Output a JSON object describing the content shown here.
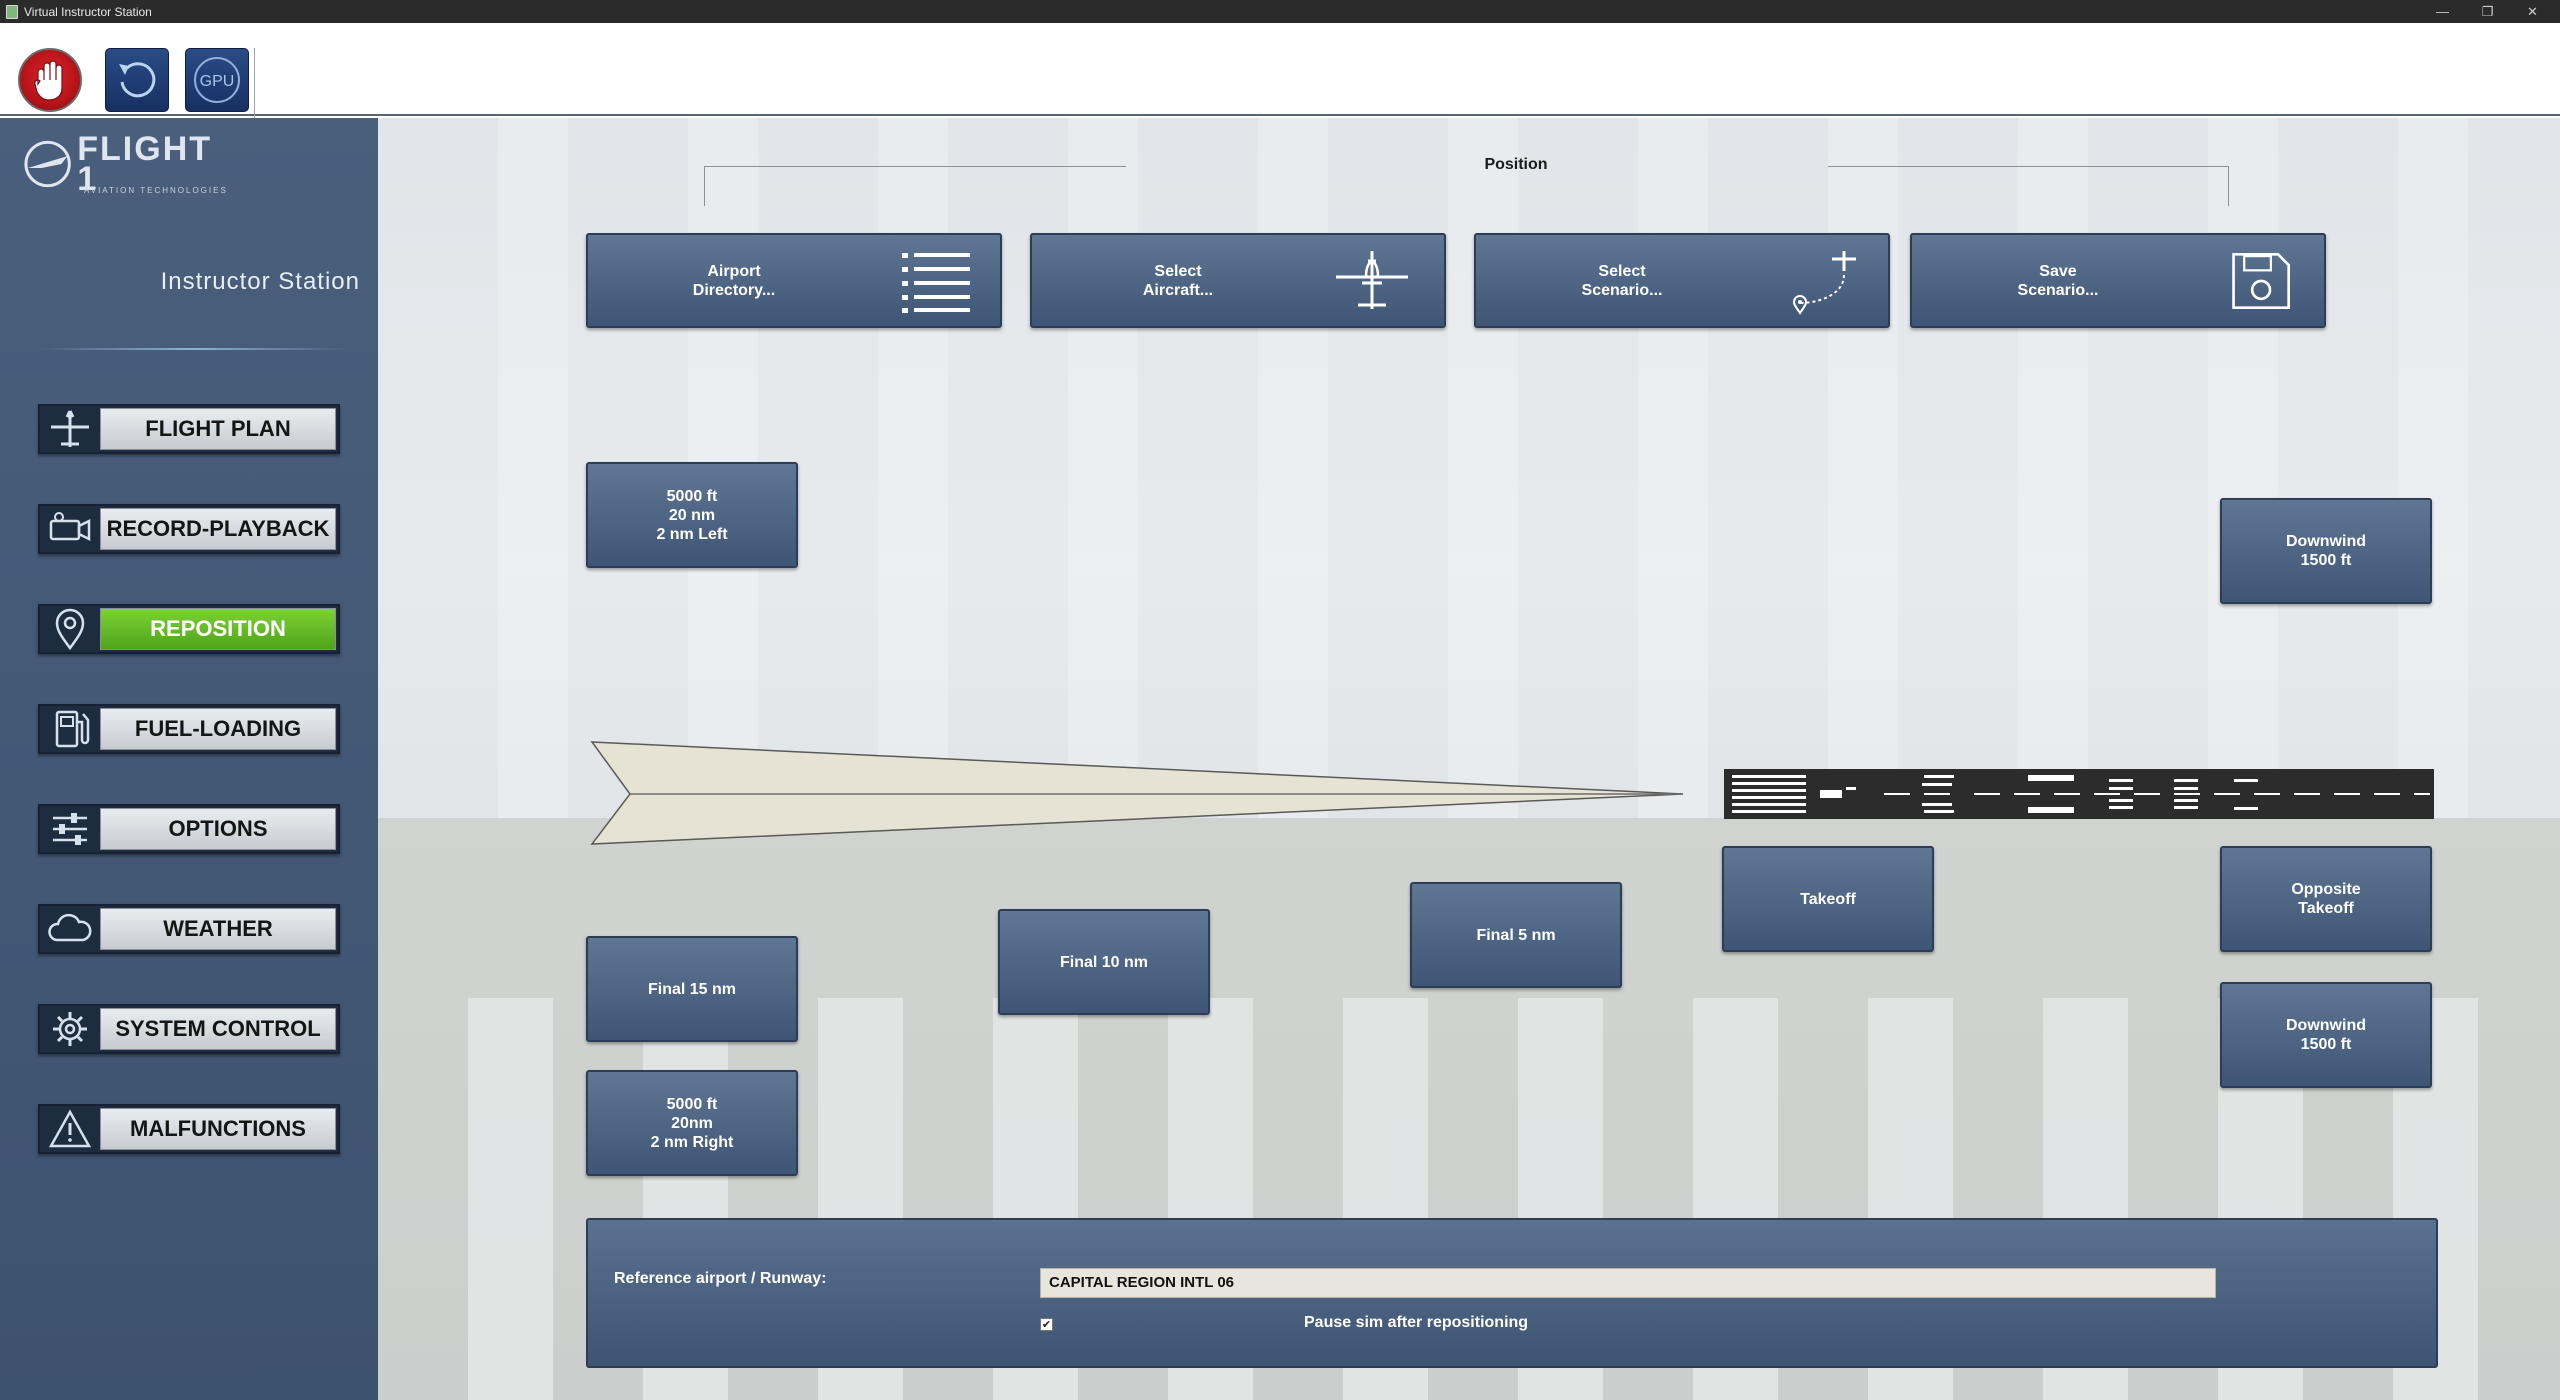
{
  "window": {
    "title": "Virtual Instructor Station",
    "controls": {
      "minimize": "—",
      "restore": "❐",
      "close": "✕"
    }
  },
  "toolbar": {
    "buttons": [
      {
        "name": "stop-hand",
        "icon": "hand-stop-icon"
      },
      {
        "name": "reset",
        "icon": "reset-arrow-icon"
      },
      {
        "name": "gpu",
        "icon": "gpu-icon",
        "label": "GPU"
      }
    ]
  },
  "sidebar": {
    "logo": {
      "text": "FLIGHT 1",
      "subtext": "AVIATION TECHNOLOGIES"
    },
    "title": "Instructor Station",
    "items": [
      {
        "label": "FLIGHT PLAN",
        "icon": "airplane-icon",
        "active": false
      },
      {
        "label": "RECORD-PLAYBACK",
        "icon": "video-camera-icon",
        "active": false
      },
      {
        "label": "REPOSITION",
        "icon": "map-pin-icon",
        "active": true
      },
      {
        "label": "FUEL-LOADING",
        "icon": "fuel-pump-icon",
        "active": false
      },
      {
        "label": "OPTIONS",
        "icon": "sliders-icon",
        "active": false
      },
      {
        "label": "WEATHER",
        "icon": "cloud-icon",
        "active": false
      },
      {
        "label": "SYSTEM CONTROL",
        "icon": "gear-icon",
        "active": false
      },
      {
        "label": "MALFUNCTIONS",
        "icon": "warning-icon",
        "active": false
      }
    ]
  },
  "main": {
    "section_title": "Position",
    "top_buttons": [
      {
        "label": "Airport\nDirectory...",
        "icon": "list-icon"
      },
      {
        "label": "Select\nAircraft...",
        "icon": "airplane-icon"
      },
      {
        "label": "Select\nScenario...",
        "icon": "route-icon"
      },
      {
        "label": "Save\nScenario...",
        "icon": "floppy-disk-icon"
      }
    ],
    "positions": {
      "left_high": "5000 ft\n20 nm\n2 nm Left",
      "downwind_top": "Downwind\n1500 ft",
      "final_15": "Final 15 nm",
      "final_10": "Final 10 nm",
      "final_5": "Final 5 nm",
      "takeoff": "Takeoff",
      "opposite_takeoff": "Opposite\nTakeoff",
      "downwind_bottom": "Downwind\n1500 ft",
      "right_high": "5000 ft\n20nm\n2 nm Right"
    },
    "reference": {
      "label": "Reference airport / Runway:",
      "value": "CAPITAL REGION INTL   06",
      "pause_label": "Pause sim after repositioning",
      "pause_checked": true,
      "check_glyph": "✔"
    }
  }
}
